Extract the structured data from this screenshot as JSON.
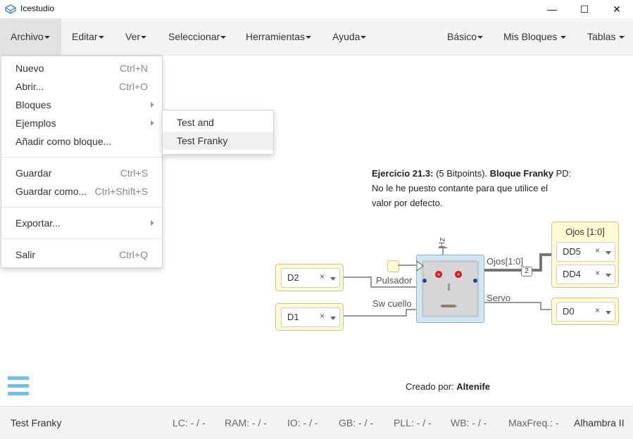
{
  "app": {
    "title": "Icestudio"
  },
  "window_controls": {
    "minimize": "—",
    "maximize": "☐",
    "close": "✕"
  },
  "menubar": {
    "archivo": "Archivo",
    "editar": "Editar",
    "ver": "Ver",
    "seleccionar": "Seleccionar",
    "herramientas": "Herramientas",
    "ayuda": "Ayuda",
    "basico": "Básico",
    "mis_bloques": "Mis Bloques",
    "tablas": "Tablas"
  },
  "archivo_menu": {
    "nuevo": {
      "label": "Nuevo",
      "shortcut": "Ctrl+N"
    },
    "abrir": {
      "label": "Abrir...",
      "shortcut": "Ctrl+O"
    },
    "bloques": {
      "label": "Bloques"
    },
    "ejemplos": {
      "label": "Ejemplos"
    },
    "anadir": {
      "label": "Añadir como bloque..."
    },
    "guardar": {
      "label": "Guardar",
      "shortcut": "Ctrl+S"
    },
    "guardar_como": {
      "label": "Guardar como...",
      "shortcut": "Ctrl+Shift+S"
    },
    "exportar": {
      "label": "Exportar..."
    },
    "salir": {
      "label": "Salir",
      "shortcut": "Ctrl+Q"
    }
  },
  "ejemplos_submenu": {
    "test_and": "Test and",
    "test_franky": "Test Franky"
  },
  "description": {
    "exercise": "Ejercicio 21.3:",
    "points": " (5 Bitpoints). ",
    "block": "Bloque Franky",
    "pd": " PD:",
    "line2": "No le he puesto contante para que utilice el",
    "line3": "valor por defecto."
  },
  "circuit": {
    "ojos_title": "Ojos [1:0]",
    "pins": {
      "dd5": "DD5",
      "dd4": "DD4",
      "d0": "D0",
      "d2": "D2",
      "d1": "D1"
    },
    "remove_symbol": "×",
    "wire_labels": {
      "pulsador": "Pulsador",
      "sw_cuello": "Sw cuello",
      "ojos": "Ojos[1:0]",
      "servo": "Servo",
      "bus_width": "2",
      "hz": "Hz"
    }
  },
  "credit": {
    "prefix": "Creado por: ",
    "author": "Altenife"
  },
  "statusbar": {
    "project": "Test Franky",
    "lc_label": "LC:",
    "lc_value": " - / -",
    "ram_label": "RAM:",
    "ram_value": " - / -",
    "io_label": "IO:",
    "io_value": " - / -",
    "gb_label": "GB:",
    "gb_value": " - / -",
    "pll_label": "PLL:",
    "pll_value": " - / -",
    "wb_label": "WB:",
    "wb_value": " - / -",
    "maxfreq_label": "MaxFreq.:",
    "maxfreq_value": " -",
    "board": "Alhambra II"
  },
  "colors": {
    "accent": "#4aa3df",
    "block_yellow": "#fffbd2",
    "block_border": "#cfc48d",
    "wire": "#777777"
  },
  "icons": {
    "app": "icestudio-logo-icon",
    "hamburger": "hamburger-menu-icon",
    "submenu": "chevron-right-icon"
  }
}
